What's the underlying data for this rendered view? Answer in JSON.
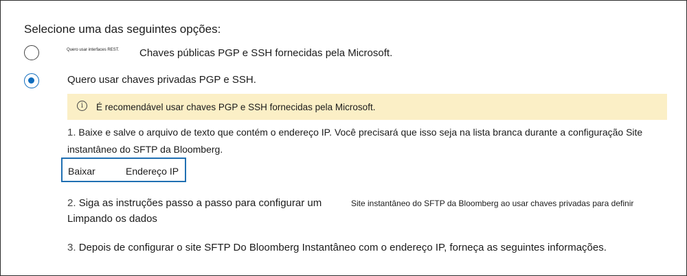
{
  "heading": "Selecione uma das seguintes opções:",
  "options": [
    {
      "small_label": "Quero usar interfaces REST.",
      "label": "Chaves públicas PGP e SSH fornecidas pela Microsoft.",
      "selected": false
    },
    {
      "label": "Quero usar chaves privadas PGP e SSH.",
      "selected": true
    }
  ],
  "banner": {
    "icon": "info-icon",
    "text": "É recomendável usar chaves PGP e SSH fornecidas pela Microsoft."
  },
  "steps": [
    {
      "number": "1.",
      "text": "Baixe e salve o arquivo de texto que contém o endereço IP. Você precisará que isso seja na lista branca durante a configuração Site instantâneo do SFTP da Bloomberg."
    },
    {
      "number": "2.",
      "text_a": "Siga as instruções passo a passo para configurar um",
      "text_b": "Site instantâneo do SFTP da Bloomberg ao usar chaves privadas para definir",
      "text_c": "Limpando os dados"
    },
    {
      "number": "3.",
      "text": "Depois de configurar o site SFTP Do Bloomberg Instantâneo com o endereço IP, forneça as seguintes informações."
    }
  ],
  "download": {
    "label_a": "Baixar",
    "label_b": "Endereço IP"
  },
  "colors": {
    "accent": "#0f6cbd",
    "banner_bg": "#fbefc6",
    "button_border": "#1f6fb2"
  }
}
